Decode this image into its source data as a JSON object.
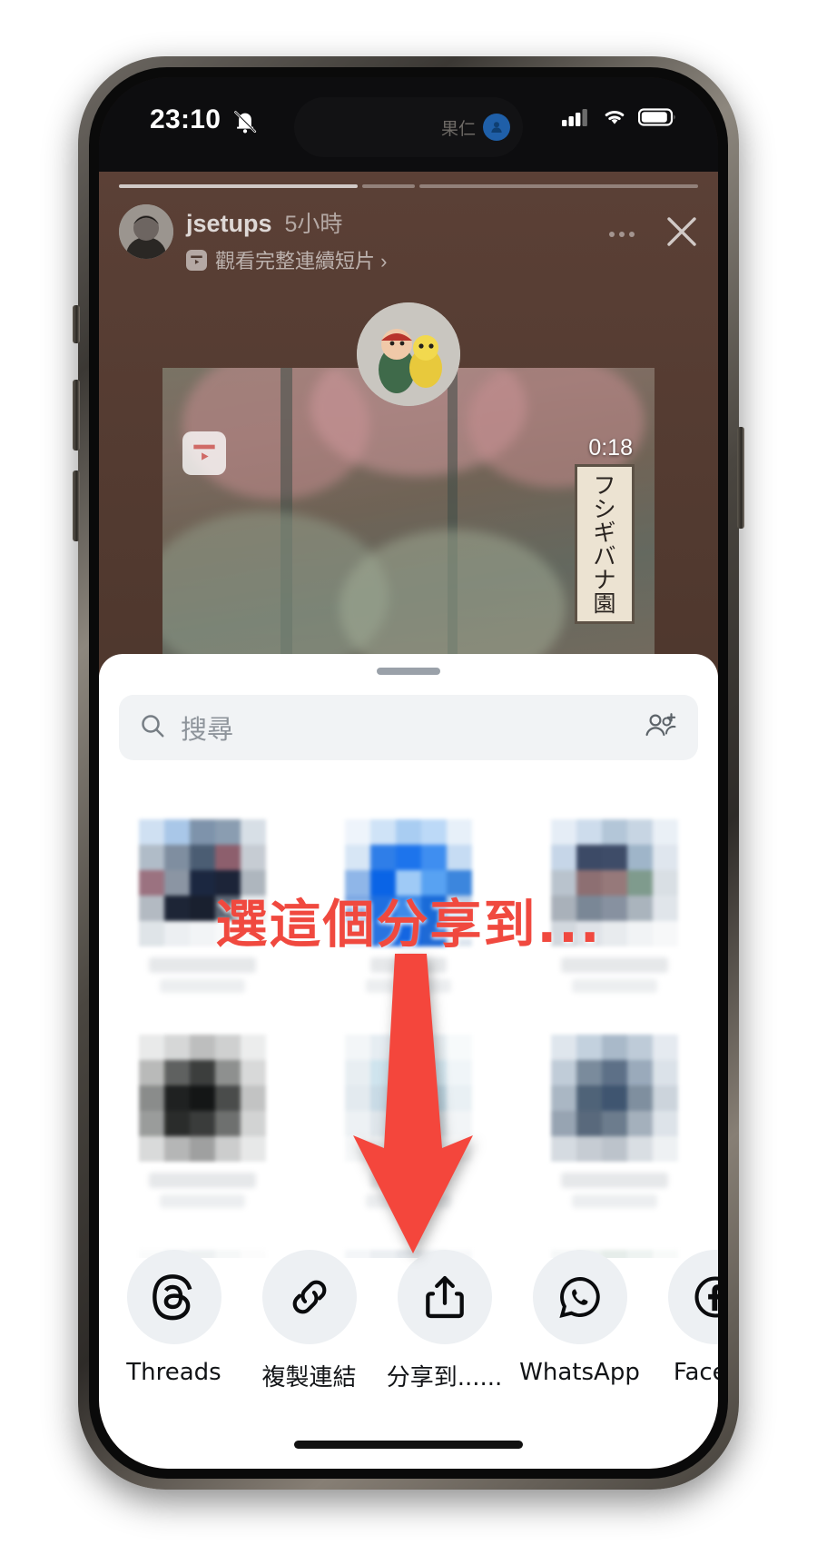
{
  "device": {
    "model_hint": "iphone-pro",
    "frame_color": "#4a4640"
  },
  "status_bar": {
    "time": "23:10",
    "silent_icon": "bell-slash-icon",
    "dynamic_island_label": "果仁",
    "dynamic_island_avatar_icon": "person-icon",
    "cellular_icon": "cellular-bars-icon",
    "wifi_icon": "wifi-icon",
    "battery_icon": "battery-icon"
  },
  "story": {
    "username": "jsetups",
    "time_ago": "5小時",
    "subtitle": "觀看完整連續短片 ›",
    "reel_badge_icon": "reels-play-icon",
    "more_icon": "more-dots-icon",
    "close_icon": "close-x-icon",
    "progress": [
      {
        "filled": true
      },
      {
        "filled": false
      },
      {
        "filled": false
      }
    ],
    "reel_card": {
      "duration": "0:18",
      "play_badge_icon": "reels-play-icon",
      "sign_text": [
        "フ",
        "シ",
        "ギ",
        "バ",
        "ナ",
        "園"
      ]
    }
  },
  "share_sheet": {
    "grabber_icon": "drag-handle-icon",
    "search": {
      "placeholder": "搜尋",
      "icon": "search-icon",
      "add_people_icon": "add-people-icon"
    },
    "contacts_rows": [
      {
        "items": [
          {
            "blurred": true,
            "palette": [
              "#cfe0f2",
              "#a9c7e8",
              "#7e93ab",
              "#8a9db1",
              "#d7dfe6",
              "#b0bcc8",
              "#7f8ea0",
              "#4b5d73",
              "#8d5f6d",
              "#c6ccd3",
              "#9b7280",
              "#8b95a3",
              "#1b2740",
              "#1c2438",
              "#aeb6be",
              "#b3bac2",
              "#1d2536",
              "#19202f",
              "#5b6472",
              "#e4e8eb",
              "#dfe4e8",
              "#eceff2",
              "#f2f4f6",
              "#f7f8f9",
              "#fbfcfc"
            ]
          },
          {
            "blurred": true,
            "palette": [
              "#eef4fb",
              "#cfe3f7",
              "#a9cdf2",
              "#bcd9f7",
              "#e7f0f9",
              "#d7e6f5",
              "#2f7ee8",
              "#1d74ec",
              "#3f8ef0",
              "#c6dcf3",
              "#8fb6e8",
              "#0a64e6",
              "#9fcaf6",
              "#58a2f2",
              "#3c86dd",
              "#7ea9e4",
              "#1f6fe0",
              "#3e8ae8",
              "#1a6bd8",
              "#b9cfe8",
              "#e2eaf3",
              "#2a74e0",
              "#1466e2",
              "#1f6ad6",
              "#dde6ef"
            ]
          },
          {
            "blurred": true,
            "palette": [
              "#e5edf6",
              "#cddcec",
              "#b3c6d8",
              "#c7d5e3",
              "#eaf0f6",
              "#c6d6e8",
              "#3c4a66",
              "#3e4c68",
              "#9fb5c9",
              "#dfe6ee",
              "#b9c3cd",
              "#8d6f72",
              "#96797a",
              "#7f9b8d",
              "#d9dfe4",
              "#a9b1ba",
              "#7a8796",
              "#8791a0",
              "#aab4bd",
              "#e0e5ea",
              "#d2d8de",
              "#dfe3e8",
              "#e8ebee",
              "#f1f3f5",
              "#f7f8f9"
            ]
          }
        ]
      },
      {
        "items": [
          {
            "blurred": true,
            "palette": [
              "#e9eaea",
              "#d6d7d7",
              "#bdbebe",
              "#cfd0d0",
              "#eceded",
              "#b9bab9",
              "#5f6160",
              "#3c3e3d",
              "#8e908f",
              "#d8d9d9",
              "#8a8c8b",
              "#1f2121",
              "#141616",
              "#4a4c4b",
              "#c2c3c3",
              "#9a9c9b",
              "#2a2c2b",
              "#3a3c3b",
              "#6e706f",
              "#d2d3d3",
              "#d9dada",
              "#b5b6b6",
              "#9fa0a0",
              "#cccdcd",
              "#e7e8e8"
            ]
          },
          {
            "blurred": true,
            "palette": [
              "#f3f6f8",
              "#e6edf2",
              "#dfe8ee",
              "#eaf1f5",
              "#f7fafb",
              "#e8eef2",
              "#cfe4ee",
              "#b8dcec",
              "#d6e9f2",
              "#f0f5f8",
              "#e3eaef",
              "#c9dbe6",
              "#9fc8dc",
              "#c3dae6",
              "#e9f0f4",
              "#edf1f4",
              "#dfe6eb",
              "#d3dde4",
              "#dde5ea",
              "#f2f5f7",
              "#f6f8f9",
              "#eef1f3",
              "#e9edf0",
              "#f0f3f5",
              "#f8f9fa"
            ]
          },
          {
            "blurred": true,
            "palette": [
              "#dfe6ed",
              "#c3d1de",
              "#a9b9c9",
              "#becbd8",
              "#e5eaf0",
              "#c0ccd8",
              "#7a8b9c",
              "#5d7087",
              "#9aaabb",
              "#dbe2e9",
              "#aab7c4",
              "#4f6378",
              "#3f5570",
              "#7f8f9f",
              "#ccd4dc",
              "#97a4b2",
              "#59697c",
              "#6c7c8d",
              "#a4b0bc",
              "#dde3e9",
              "#d5dbe1",
              "#c6ccd3",
              "#bcc3cb",
              "#d9dee3",
              "#eef1f3"
            ]
          }
        ]
      },
      {
        "items": [
          {
            "blurred": true,
            "palette": [
              "#fafbfb",
              "#f3f5f6",
              "#eef1f2",
              "#f6f8f8",
              "#fcfcfc",
              "#f2f4f5",
              "#e6e9ea",
              "#e0e4e5",
              "#eef0f1",
              "#f8f9f9",
              "#e9ebec",
              "#dcdfe0",
              "#d8dbdc",
              "#e4e7e8",
              "#f1f3f3",
              "#eef0f1",
              "#e3e6e7",
              "#dfe2e3",
              "#e8eaeb",
              "#f4f5f6",
              "#f8f9f9",
              "#f2f3f4",
              "#eef0f0",
              "#f5f6f7",
              "#fbfbfb"
            ]
          },
          {
            "blurred": true,
            "palette": [
              "#f4f6f8",
              "#eceff2",
              "#e4e8ec",
              "#eef1f4",
              "#f8f9fa",
              "#eceff2",
              "#dde2e7",
              "#cdd4dc",
              "#e3e7eb",
              "#f3f5f7",
              "#e7eaee",
              "#c7ced6",
              "#8d99a8",
              "#cfd6dd",
              "#eff1f4",
              "#e9ecef",
              "#d4dae0",
              "#3b4654",
              "#c0c7ce",
              "#eceef1",
              "#f2f4f5",
              "#e8ebed",
              "#dfe3e6",
              "#edeff1",
              "#f7f8f9"
            ]
          },
          {
            "blurred": true,
            "palette": [
              "#f6f8f8",
              "#eef2f1",
              "#e6edea",
              "#eef3f1",
              "#f8faf9",
              "#f0f4f2",
              "#dfe6e2",
              "#7fae92",
              "#dfeae3",
              "#f4f8f6",
              "#edf1ef",
              "#d9e0dc",
              "#8cb79c",
              "#e1eae4",
              "#f3f7f5",
              "#d98f8f",
              "#d2807f",
              "#f1dcdc",
              "#eab9b8",
              "#f6e3e3",
              "#dd9a99",
              "#d88a89",
              "#f3e0e0",
              "#edc4c3",
              "#f8e9e9"
            ]
          }
        ]
      }
    ],
    "apps": [
      {
        "label": "Threads",
        "icon": "threads-icon"
      },
      {
        "label": "複製連結",
        "icon": "link-icon"
      },
      {
        "label": "分享到......",
        "icon": "share-out-icon"
      },
      {
        "label": "WhatsApp",
        "icon": "whatsapp-icon"
      },
      {
        "label": "Facebo",
        "icon": "facebook-icon"
      }
    ]
  },
  "annotation": {
    "text": "選這個分享到...",
    "color": "#f0493f",
    "arrow_icon": "down-arrow-annotation-icon"
  },
  "home_indicator_icon": "home-indicator"
}
